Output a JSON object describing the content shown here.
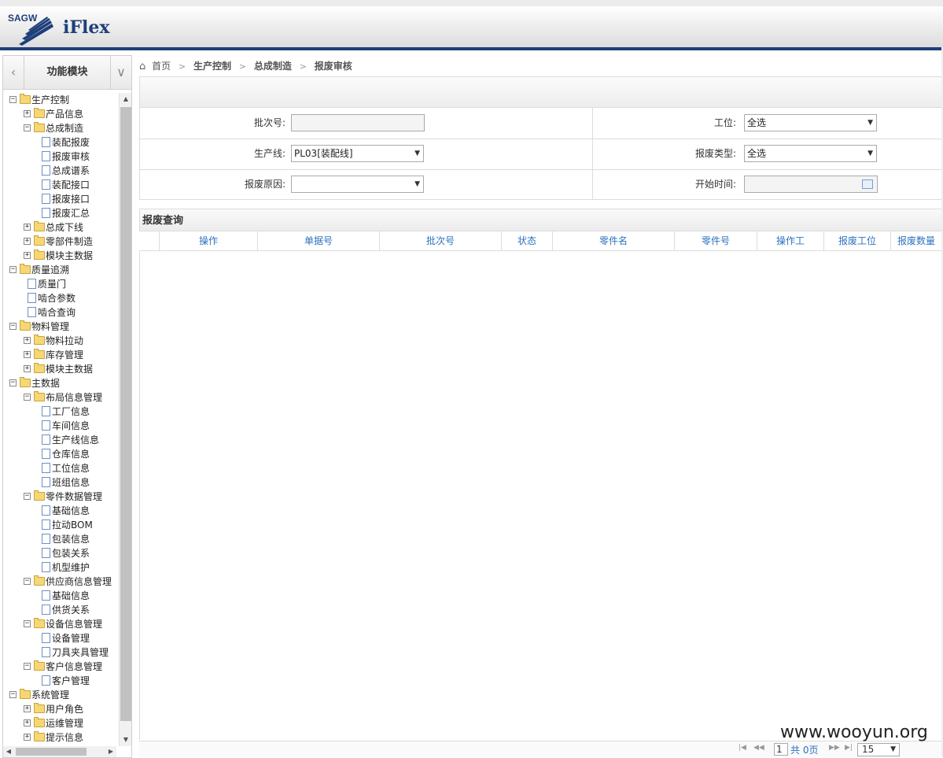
{
  "app": {
    "logo_text": "SAGW",
    "name": "iFlex"
  },
  "sidebar": {
    "module_title": "功能模块",
    "prev_icon": "chevron-left-icon",
    "next_icon": "chevron-down-icon",
    "tree": [
      {
        "label": "生产控制",
        "level": 0,
        "type": "folder",
        "state": "open"
      },
      {
        "label": "产品信息",
        "level": 1,
        "type": "folder",
        "state": "closed"
      },
      {
        "label": "总成制造",
        "level": 1,
        "type": "folder",
        "state": "open"
      },
      {
        "label": "装配报废",
        "level": 2,
        "type": "page"
      },
      {
        "label": "报废审核",
        "level": 2,
        "type": "page"
      },
      {
        "label": "总成谱系",
        "level": 2,
        "type": "page"
      },
      {
        "label": "装配接口",
        "level": 2,
        "type": "page"
      },
      {
        "label": "报废接口",
        "level": 2,
        "type": "page"
      },
      {
        "label": "报废汇总",
        "level": 2,
        "type": "page"
      },
      {
        "label": "总成下线",
        "level": 1,
        "type": "folder",
        "state": "closed"
      },
      {
        "label": "零部件制造",
        "level": 1,
        "type": "folder",
        "state": "closed"
      },
      {
        "label": "模块主数据",
        "level": 1,
        "type": "folder",
        "state": "closed"
      },
      {
        "label": "质量追溯",
        "level": 0,
        "type": "folder",
        "state": "open"
      },
      {
        "label": "质量门",
        "level": 1,
        "type": "page"
      },
      {
        "label": "啮合参数",
        "level": 1,
        "type": "page"
      },
      {
        "label": "啮合查询",
        "level": 1,
        "type": "page"
      },
      {
        "label": "物料管理",
        "level": 0,
        "type": "folder",
        "state": "open"
      },
      {
        "label": "物料拉动",
        "level": 1,
        "type": "folder",
        "state": "closed"
      },
      {
        "label": "库存管理",
        "level": 1,
        "type": "folder",
        "state": "closed"
      },
      {
        "label": "模块主数据",
        "level": 1,
        "type": "folder",
        "state": "closed"
      },
      {
        "label": "主数据",
        "level": 0,
        "type": "folder",
        "state": "open"
      },
      {
        "label": "布局信息管理",
        "level": 1,
        "type": "folder",
        "state": "open"
      },
      {
        "label": "工厂信息",
        "level": 2,
        "type": "page"
      },
      {
        "label": "车间信息",
        "level": 2,
        "type": "page"
      },
      {
        "label": "生产线信息",
        "level": 2,
        "type": "page"
      },
      {
        "label": "仓库信息",
        "level": 2,
        "type": "page"
      },
      {
        "label": "工位信息",
        "level": 2,
        "type": "page"
      },
      {
        "label": "班组信息",
        "level": 2,
        "type": "page"
      },
      {
        "label": "零件数据管理",
        "level": 1,
        "type": "folder",
        "state": "open"
      },
      {
        "label": "基础信息",
        "level": 2,
        "type": "page"
      },
      {
        "label": "拉动BOM",
        "level": 2,
        "type": "page"
      },
      {
        "label": "包装信息",
        "level": 2,
        "type": "page"
      },
      {
        "label": "包装关系",
        "level": 2,
        "type": "page"
      },
      {
        "label": "机型维护",
        "level": 2,
        "type": "page"
      },
      {
        "label": "供应商信息管理",
        "level": 1,
        "type": "folder",
        "state": "open"
      },
      {
        "label": "基础信息",
        "level": 2,
        "type": "page"
      },
      {
        "label": "供货关系",
        "level": 2,
        "type": "page"
      },
      {
        "label": "设备信息管理",
        "level": 1,
        "type": "folder",
        "state": "open"
      },
      {
        "label": "设备管理",
        "level": 2,
        "type": "page"
      },
      {
        "label": "刀具夹具管理",
        "level": 2,
        "type": "page"
      },
      {
        "label": "客户信息管理",
        "level": 1,
        "type": "folder",
        "state": "open"
      },
      {
        "label": "客户管理",
        "level": 2,
        "type": "page"
      },
      {
        "label": "系统管理",
        "level": 0,
        "type": "folder",
        "state": "open"
      },
      {
        "label": "用户角色",
        "level": 1,
        "type": "folder",
        "state": "closed"
      },
      {
        "label": "运维管理",
        "level": 1,
        "type": "folder",
        "state": "closed"
      },
      {
        "label": "提示信息",
        "level": 1,
        "type": "folder",
        "state": "closed"
      }
    ]
  },
  "breadcrumb": {
    "home_icon": "home-icon",
    "items": [
      "首页",
      "生产控制",
      "总成制造",
      "报废审核"
    ]
  },
  "form": {
    "batch_label": "批次号:",
    "batch_value": "",
    "station_label": "工位:",
    "station_value": "全选",
    "line_label": "生产线:",
    "line_value": "PL03[装配线]",
    "scrap_type_label": "报废类型:",
    "scrap_type_value": "全选",
    "scrap_reason_label": "报废原因:",
    "scrap_reason_value": "",
    "start_time_label": "开始时间:",
    "start_time_value": "",
    "calendar_icon": "calendar-icon"
  },
  "grid": {
    "title": "报废查询",
    "columns": [
      "操作",
      "单据号",
      "批次号",
      "状态",
      "零件名",
      "零件号",
      "操作工",
      "报废工位",
      "报废数量"
    ],
    "rows": []
  },
  "pager": {
    "page": "1",
    "total_text": "共 0页",
    "page_size": "15"
  },
  "watermark": "www.wooyun.org",
  "colors": {
    "brand": "#1e3f7a",
    "link": "#2b72c0"
  }
}
